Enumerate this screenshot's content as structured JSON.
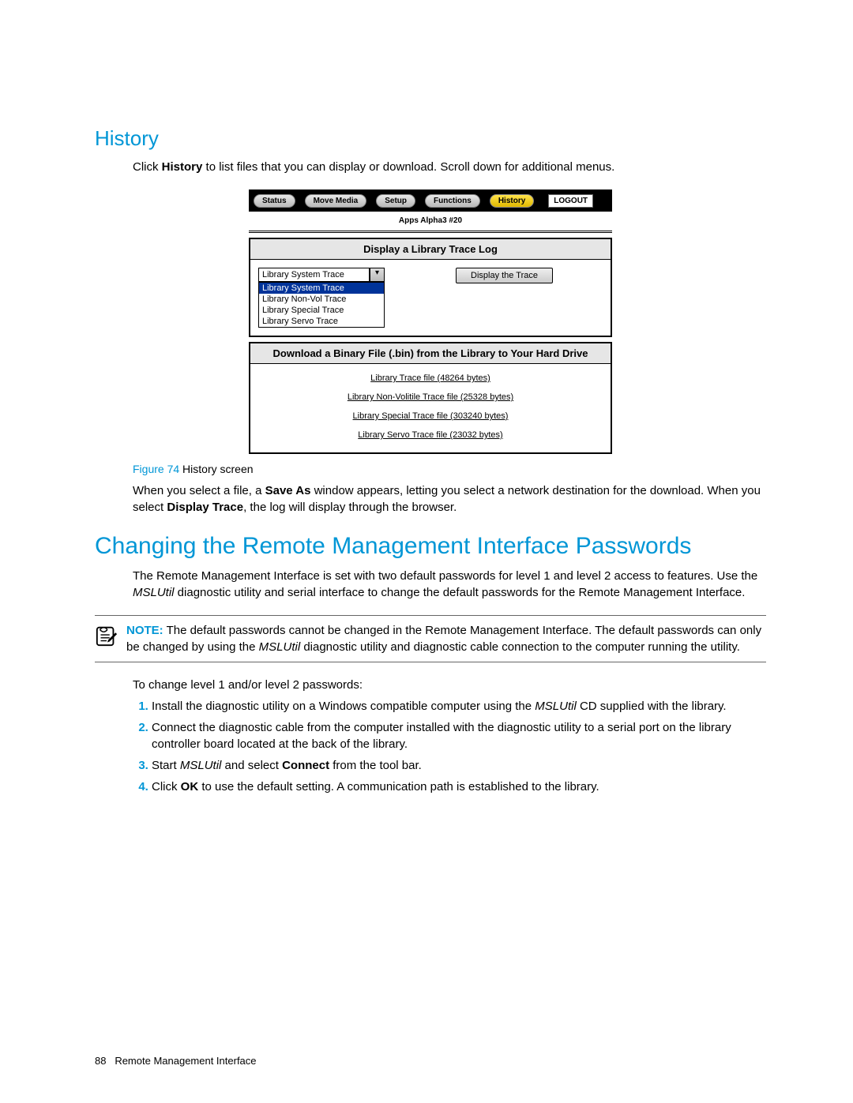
{
  "section1": {
    "heading": "History",
    "intro_pre": "Click ",
    "intro_bold": "History",
    "intro_post": " to list files that you can display or download. Scroll down for additional menus."
  },
  "nav": {
    "items": [
      "Status",
      "Move Media",
      "Setup",
      "Functions",
      "History"
    ],
    "active_index": 4,
    "logout": "LOGOUT",
    "subtitle": "Apps Alpha3 #20"
  },
  "trace_panel": {
    "title": "Display a Library Trace Log",
    "selected": "Library System Trace",
    "options": [
      "Library System Trace",
      "Library Non-Vol Trace",
      "Library Special Trace",
      "Library Servo Trace"
    ],
    "button": "Display the Trace"
  },
  "download_panel": {
    "title": "Download a Binary File (.bin) from the Library to Your Hard Drive",
    "links": [
      "Library Trace file (48264 bytes)",
      "Library Non-Volitile Trace file (25328 bytes)",
      "Library Special Trace file (303240 bytes)",
      "Library Servo Trace file (23032 bytes)"
    ]
  },
  "figure": {
    "label": "Figure 74",
    "caption": " History screen"
  },
  "after_figure": {
    "p1a": "When you select a file, a ",
    "p1b": "Save As",
    "p1c": " window appears, letting you select a network destination for the download. When you select ",
    "p1d": "Display Trace",
    "p1e": ", the log will display through the browser."
  },
  "section2": {
    "heading": "Changing the Remote Management Interface Passwords",
    "para_a": "The Remote Management Interface is set with two default passwords for level 1 and level 2 access to features. Use the ",
    "para_b": "MSLUtil",
    "para_c": " diagnostic utility and serial interface to change the default passwords for the Remote Management Interface."
  },
  "note": {
    "label": "NOTE:",
    "text_a": "   The default passwords cannot be changed in the Remote Management Interface. The default passwords can only be changed by using the ",
    "text_b": "MSLUtil",
    "text_c": " diagnostic utility and diagnostic cable connection to the computer running the utility."
  },
  "steps_intro": "To change level 1 and/or level 2 passwords:",
  "steps": [
    {
      "a": "Install the diagnostic utility on a Windows compatible computer using the ",
      "i": "MSLUtil",
      "b": " CD supplied with the library."
    },
    {
      "a": "Connect the diagnostic cable from the computer installed with the diagnostic utility to a serial port on the library controller board located at the back of the library."
    },
    {
      "a": "Start ",
      "i": "MSLUtil",
      "b": " and select ",
      "bold": "Connect",
      "c": " from the tool bar."
    },
    {
      "a": "Click ",
      "bold": "OK",
      "b": " to use the default setting. A communication path is established to the library."
    }
  ],
  "footer": {
    "page": "88",
    "title": "Remote Management Interface"
  }
}
